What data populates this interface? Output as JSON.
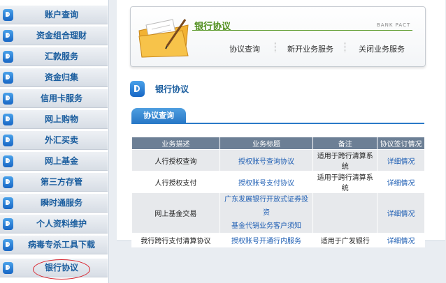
{
  "sidebar": {
    "items": [
      {
        "label": "账户查询"
      },
      {
        "label": "资金组合理财"
      },
      {
        "label": "汇款服务"
      },
      {
        "label": "资金归集"
      },
      {
        "label": "信用卡服务"
      },
      {
        "label": "网上购物"
      },
      {
        "label": "外汇买卖"
      },
      {
        "label": "网上基金"
      },
      {
        "label": "第三方存管"
      },
      {
        "label": "瞬时通服务"
      },
      {
        "label": "个人资料维护"
      },
      {
        "label": "病毒专杀工具下载"
      },
      {
        "label": "银行协议"
      }
    ],
    "active_index": 12
  },
  "banner": {
    "title": "银行协议",
    "subtitle": "BANK PACT",
    "nav": [
      "协议查询",
      "新开业务服务",
      "关闭业务服务"
    ]
  },
  "section": {
    "title": "银行协议",
    "tab": "协议查询"
  },
  "table": {
    "headers": [
      "业务描述",
      "业务标题",
      "备注",
      "协议签订情况"
    ],
    "rows": [
      {
        "desc": "人行授权查询",
        "title1": "授权账号查询协议",
        "title2": "",
        "note": "适用于跨行清算系统",
        "status": "详细情况"
      },
      {
        "desc": "人行授权支付",
        "title1": "授权账号支付协议",
        "title2": "",
        "note": "适用于跨行清算系统",
        "status": "详细情况"
      },
      {
        "desc": "网上基金交易",
        "title1": "广东发展银行开放式证券投资",
        "title2": "基金代销业务客户须知",
        "note": "",
        "status": "详细情况"
      },
      {
        "desc": "我行跨行支付清算协议",
        "title1": "授权账号开通行内服务",
        "title2": "",
        "note": "适用于广发银行",
        "status": "详细情况"
      }
    ]
  },
  "colors": {
    "link": "#1f5fb4",
    "header_bg": "#6c7f95",
    "accent_green": "#4f8d1b",
    "tab_blue": "#2a7ac8"
  }
}
